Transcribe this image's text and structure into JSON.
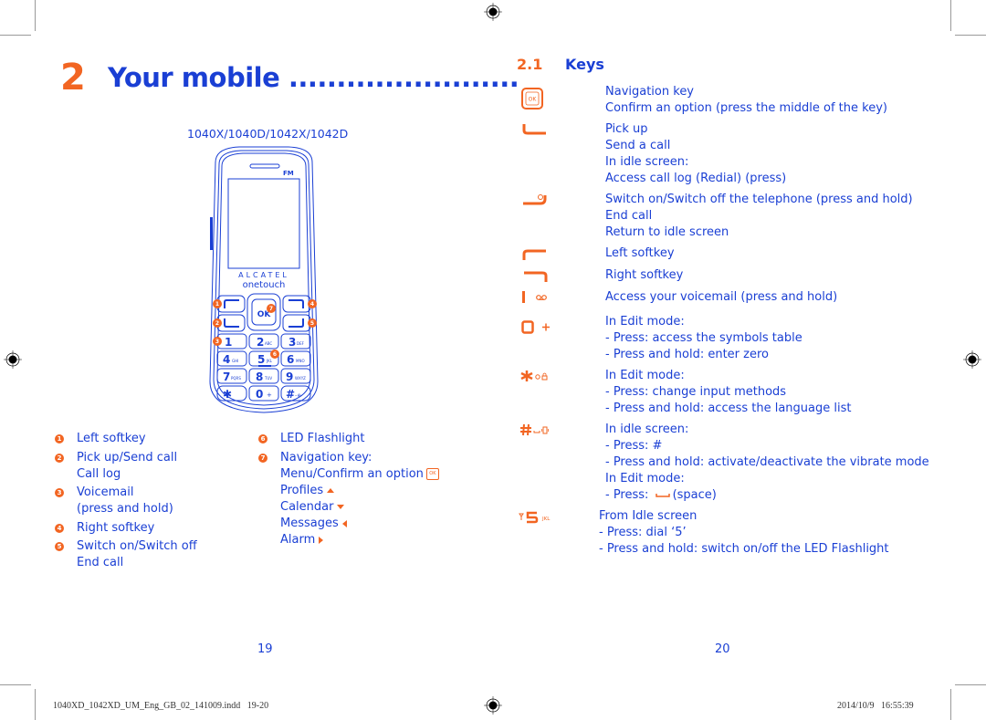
{
  "left_page": {
    "chapter_number": "2",
    "chapter_title": "Your mobile ........................",
    "model": "1040X/1040D/1042X/1042D",
    "phone": {
      "brand_line1": "ALCATEL",
      "brand_line2": "onetouch",
      "fm_label": "FM",
      "ok_label": "OK",
      "keys": [
        {
          "num": "1",
          "letters": "ꝏ"
        },
        {
          "num": "2",
          "letters": "ABC"
        },
        {
          "num": "3",
          "letters": "DEF"
        },
        {
          "num": "4",
          "letters": "GHI"
        },
        {
          "num": "5",
          "letters": "JKL"
        },
        {
          "num": "6",
          "letters": "MNO"
        },
        {
          "num": "7",
          "letters": "PQRS"
        },
        {
          "num": "8",
          "letters": "TUV"
        },
        {
          "num": "9",
          "letters": "WXYZ"
        },
        {
          "num": "✱",
          "letters": "ꝏ"
        },
        {
          "num": "0",
          "letters": "+"
        },
        {
          "num": "#",
          "letters": "–⊕"
        }
      ],
      "callouts": [
        "1",
        "2",
        "3",
        "4",
        "5",
        "6",
        "7"
      ]
    },
    "legend_left": [
      {
        "bullet": "1",
        "lines": [
          "Left softkey"
        ]
      },
      {
        "bullet": "2",
        "lines": [
          "Pick up/Send call",
          "Call log"
        ]
      },
      {
        "bullet": "3",
        "lines": [
          "Voicemail",
          "(press and hold)"
        ]
      },
      {
        "bullet": "4",
        "lines": [
          "Right softkey"
        ]
      },
      {
        "bullet": "5",
        "lines": [
          "Switch on/Switch off",
          "End call"
        ]
      }
    ],
    "legend_right": {
      "item6": {
        "bullet": "6",
        "label": "LED Flashlight"
      },
      "item7": {
        "bullet": "7",
        "label": "Navigation key:",
        "menu": "Menu/Confirm an option",
        "ok_icon": "OK",
        "profiles": "Profiles",
        "calendar": "Calendar",
        "messages": "Messages",
        "alarm": "Alarm"
      }
    },
    "page_number": "19"
  },
  "right_page": {
    "section_number": "2.1",
    "section_title": "Keys",
    "keys": [
      {
        "icon": "navigation-ok-key",
        "lines": [
          "Navigation key",
          "Confirm an option (press the middle of the key)"
        ]
      },
      {
        "icon": "pick-up-key",
        "lines": [
          "Pick up",
          "Send a call",
          "In idle screen:",
          "Access call log (Redial) (press)"
        ]
      },
      {
        "icon": "power-end-key",
        "lines": [
          "Switch on/Switch off the telephone (press and hold)",
          "End call",
          "Return to idle screen"
        ]
      },
      {
        "icon": "left-softkey",
        "lines": [
          "Left softkey"
        ]
      },
      {
        "icon": "right-softkey",
        "lines": [
          "Right softkey"
        ]
      },
      {
        "icon": "voicemail-key",
        "lines": [
          "Access your voicemail (press and hold)"
        ]
      },
      {
        "icon": "zero-key",
        "glyph": "0 +",
        "lines": [
          "In Edit mode:",
          "- Press: access the symbols table",
          "- Press and hold: enter zero"
        ]
      },
      {
        "icon": "star-key",
        "glyph": "✱",
        "lines": [
          "In Edit mode:",
          "- Press: change input methods",
          "- Press and hold: access the language list"
        ]
      },
      {
        "icon": "hash-key",
        "glyph": "#",
        "lines": [
          "In idle screen:",
          "- Press: #",
          "- Press and hold: activate/deactivate the vibrate mode",
          "In Edit mode:",
          "- Press:",
          "(space)"
        ]
      },
      {
        "icon": "five-key",
        "glyph": "5",
        "sub": "JKL",
        "lines": [
          "From Idle screen",
          "- Press: dial ‘5’",
          "- Press and hold: switch on/off the LED Flashlight"
        ]
      }
    ],
    "page_number": "20"
  },
  "footer": {
    "file_slug": "1040XD_1042XD_UM_Eng_GB_02_141009.indd   19-20",
    "timestamp": "2014/10/9   16:55:39"
  },
  "colors": {
    "text_blue": "#1a3fd4",
    "accent_orange": "#f26522",
    "crop_marks": "#9a9a9a"
  }
}
